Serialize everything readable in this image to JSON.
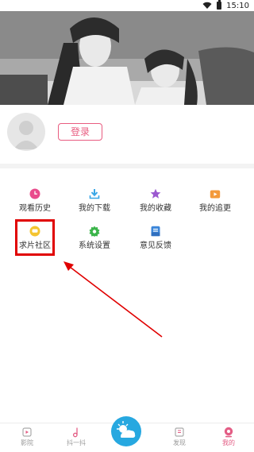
{
  "status": {
    "time": "15:10"
  },
  "profile": {
    "login_label": "登录"
  },
  "menu": {
    "items": [
      {
        "label": "观看历史",
        "icon": "clock-icon",
        "color": "#e94b8c"
      },
      {
        "label": "我的下载",
        "icon": "download-icon",
        "color": "#3aa7e6"
      },
      {
        "label": "我的收藏",
        "icon": "star-icon",
        "color": "#9b59d0"
      },
      {
        "label": "我的追更",
        "icon": "tv-icon",
        "color": "#f39a3c"
      },
      {
        "label": "求片社区",
        "icon": "chat-bubble-icon",
        "color": "#f4c430"
      },
      {
        "label": "系统设置",
        "icon": "gear-icon",
        "color": "#3bb54a"
      },
      {
        "label": "意见反馈",
        "icon": "mail-icon",
        "color": "#3c86d9"
      }
    ]
  },
  "tabbar": {
    "tabs": [
      {
        "label": "影院",
        "icon": "cinema-icon"
      },
      {
        "label": "抖一抖",
        "icon": "music-note-icon"
      },
      {
        "label": "",
        "icon": "weather-icon"
      },
      {
        "label": "发现",
        "icon": "discover-icon"
      },
      {
        "label": "我的",
        "icon": "profile-icon",
        "active": true
      }
    ]
  },
  "colors": {
    "accent": "#e35d85",
    "highlight": "#e00000",
    "center": "#27a8e0"
  }
}
